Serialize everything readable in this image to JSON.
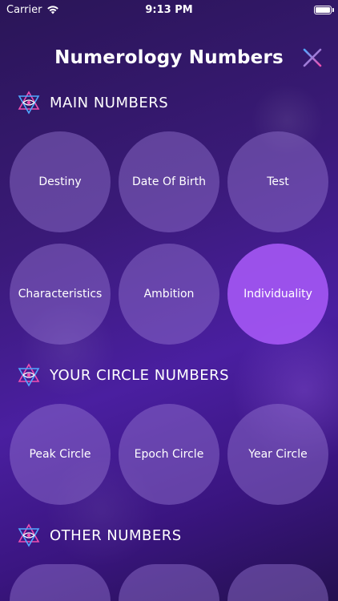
{
  "status": {
    "carrier": "Carrier",
    "time": "9:13 PM"
  },
  "header": {
    "title": "Numerology Numbers"
  },
  "sections": {
    "main": {
      "title": "MAIN NUMBERS",
      "items": [
        "Destiny",
        "Date Of Birth",
        "Test",
        "Characteristics",
        "Ambition",
        "Individuality"
      ]
    },
    "circle": {
      "title": "YOUR CIRCLE NUMBERS",
      "items": [
        "Peak Circle",
        "Epoch Circle",
        "Year Circle"
      ]
    },
    "other": {
      "title": "OTHER NUMBERS"
    }
  },
  "colors": {
    "accent_pink": "#f04fb0",
    "accent_blue": "#4fa8ff",
    "active_circle": "#a75af8"
  }
}
